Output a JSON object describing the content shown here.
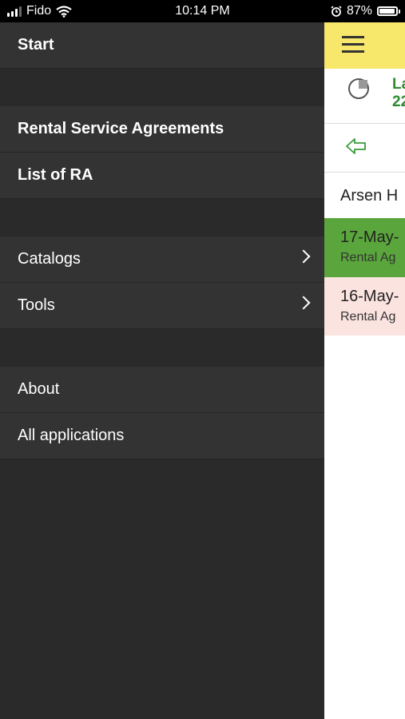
{
  "status_bar": {
    "carrier": "Fido",
    "time": "10:14 PM",
    "battery_percent": "87%",
    "battery_level": 0.87
  },
  "drawer": {
    "start": "Start",
    "rental_service_agreements": "Rental Service Agreements",
    "list_of_ra": "List of RA",
    "catalogs": "Catalogs",
    "tools": "Tools",
    "about": "About",
    "all_applications": "All applications"
  },
  "main": {
    "info_line1": "La",
    "info_line2": "22",
    "customer_name": "Arsen H",
    "rows": [
      {
        "date": "17-May-",
        "subtitle": "Rental Ag",
        "color": "#5aa63c"
      },
      {
        "date": "16-May-",
        "subtitle": "Rental Ag",
        "color": "#fbe3e0"
      }
    ]
  },
  "colors": {
    "drawer_bg": "#2a2a2a",
    "menu_item_bg": "#333333",
    "topbar_yellow": "#f7e76a",
    "accent_green": "#2e8b2e"
  }
}
